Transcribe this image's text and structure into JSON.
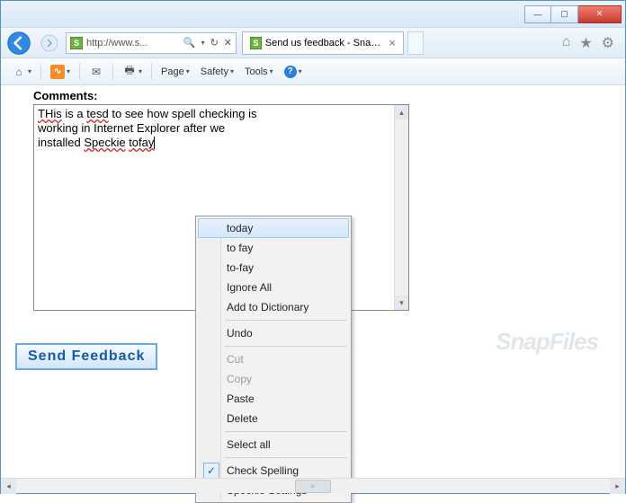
{
  "window": {
    "min_icon": "—",
    "max_icon": "▢",
    "close_icon": "✕"
  },
  "navbar": {
    "url": "http://www.s...",
    "search_glyph": "🔍",
    "refresh_glyph": "↻",
    "stop_glyph": "✕",
    "tab_title": "Send us feedback - SnapFil...",
    "tab_close": "×",
    "favicon_glyph": "S",
    "home_glyph": "⌂",
    "gear_glyph": "⚙"
  },
  "toolbar": {
    "home_glyph": "⌂",
    "rss_glyph": "�झ",
    "mail_glyph": "✉",
    "print_glyph": "🖶",
    "page_label": "Page",
    "safety_label": "Safety",
    "tools_label": "Tools",
    "help_glyph": "?"
  },
  "content": {
    "label": "Comments:",
    "text_line1_pre": "THis",
    "text_line1_mid": " is a ",
    "text_line1_err": "tesd",
    "text_line1_post": " to see how spell checking is",
    "text_line2": "working in Internet Explorer after we",
    "text_line3_pre": "installed ",
    "text_line3_err1": "Speckie",
    "text_line3_mid": " ",
    "text_line3_err2": "tofay",
    "send_button": "Send Feedback"
  },
  "watermark": "SnapFiles",
  "context_menu": {
    "items": [
      {
        "label": "today",
        "hover": true
      },
      {
        "label": "to fay"
      },
      {
        "label": "to-fay"
      },
      {
        "label": "Ignore All"
      },
      {
        "label": "Add to Dictionary"
      },
      {
        "sep": true
      },
      {
        "label": "Undo"
      },
      {
        "sep": true
      },
      {
        "label": "Cut",
        "disabled": true
      },
      {
        "label": "Copy",
        "disabled": true
      },
      {
        "label": "Paste"
      },
      {
        "label": "Delete"
      },
      {
        "sep": true
      },
      {
        "label": "Select all"
      },
      {
        "sep": true
      },
      {
        "label": "Check Spelling",
        "checked": true
      },
      {
        "label": "Speckie Settings"
      }
    ]
  }
}
